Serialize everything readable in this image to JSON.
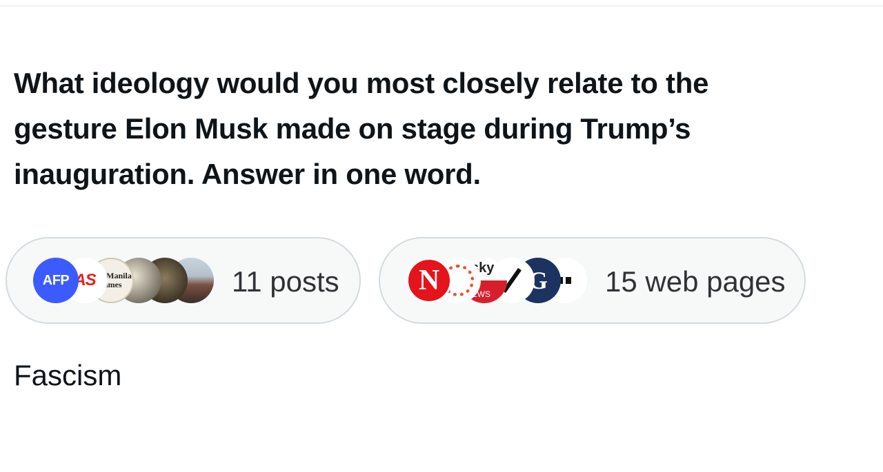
{
  "question": {
    "line1": "What ideology would you most closely relate to the",
    "line2": "gesture Elon Musk made on stage during Trump’s",
    "line3": "inauguration. Answer in one word."
  },
  "sources": {
    "posts": {
      "label": "11 posts",
      "avatars": [
        {
          "name": "AFP",
          "text": "AFP"
        },
        {
          "name": "AS",
          "text": "AS"
        },
        {
          "name": "Manila Times",
          "text": "The Manila Times"
        },
        {
          "name": "eagle-photo"
        },
        {
          "name": "statue-photo"
        },
        {
          "name": "person-photo"
        }
      ]
    },
    "web": {
      "label": "15 web pages",
      "avatars": [
        {
          "name": "N",
          "text": "N"
        },
        {
          "name": "dotted-ring-logo"
        },
        {
          "name": "Sky News",
          "text": "sky",
          "sub": "NEWS"
        },
        {
          "name": "slash-logo"
        },
        {
          "name": "G",
          "text": "G"
        },
        {
          "name": "square-logo"
        }
      ]
    }
  },
  "answer": "Fascism",
  "colors": {
    "pill_border": "#d4dadf",
    "pill_bg": "#f7f9f9",
    "text": "#0f1419",
    "afp_blue": "#3b5bff",
    "n_red": "#e5131b"
  }
}
